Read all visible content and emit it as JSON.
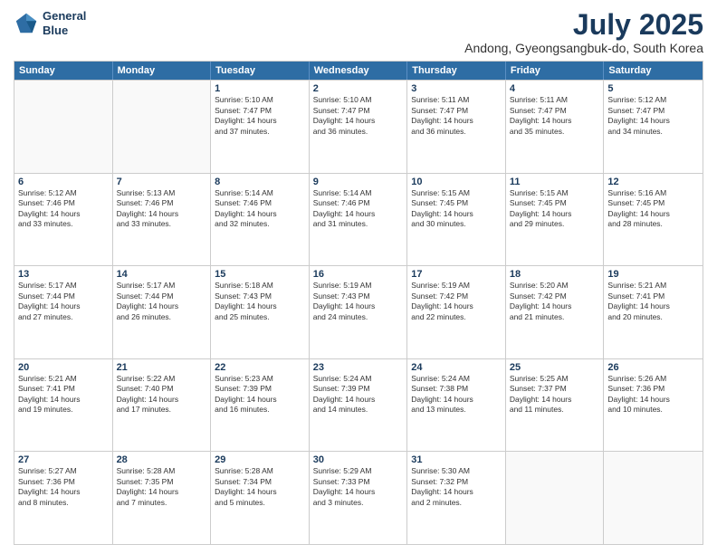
{
  "header": {
    "logo_line1": "General",
    "logo_line2": "Blue",
    "main_title": "July 2025",
    "subtitle": "Andong, Gyeongsangbuk-do, South Korea"
  },
  "days_of_week": [
    "Sunday",
    "Monday",
    "Tuesday",
    "Wednesday",
    "Thursday",
    "Friday",
    "Saturday"
  ],
  "weeks": [
    [
      {
        "day": "",
        "lines": []
      },
      {
        "day": "",
        "lines": []
      },
      {
        "day": "1",
        "lines": [
          "Sunrise: 5:10 AM",
          "Sunset: 7:47 PM",
          "Daylight: 14 hours",
          "and 37 minutes."
        ]
      },
      {
        "day": "2",
        "lines": [
          "Sunrise: 5:10 AM",
          "Sunset: 7:47 PM",
          "Daylight: 14 hours",
          "and 36 minutes."
        ]
      },
      {
        "day": "3",
        "lines": [
          "Sunrise: 5:11 AM",
          "Sunset: 7:47 PM",
          "Daylight: 14 hours",
          "and 36 minutes."
        ]
      },
      {
        "day": "4",
        "lines": [
          "Sunrise: 5:11 AM",
          "Sunset: 7:47 PM",
          "Daylight: 14 hours",
          "and 35 minutes."
        ]
      },
      {
        "day": "5",
        "lines": [
          "Sunrise: 5:12 AM",
          "Sunset: 7:47 PM",
          "Daylight: 14 hours",
          "and 34 minutes."
        ]
      }
    ],
    [
      {
        "day": "6",
        "lines": [
          "Sunrise: 5:12 AM",
          "Sunset: 7:46 PM",
          "Daylight: 14 hours",
          "and 33 minutes."
        ]
      },
      {
        "day": "7",
        "lines": [
          "Sunrise: 5:13 AM",
          "Sunset: 7:46 PM",
          "Daylight: 14 hours",
          "and 33 minutes."
        ]
      },
      {
        "day": "8",
        "lines": [
          "Sunrise: 5:14 AM",
          "Sunset: 7:46 PM",
          "Daylight: 14 hours",
          "and 32 minutes."
        ]
      },
      {
        "day": "9",
        "lines": [
          "Sunrise: 5:14 AM",
          "Sunset: 7:46 PM",
          "Daylight: 14 hours",
          "and 31 minutes."
        ]
      },
      {
        "day": "10",
        "lines": [
          "Sunrise: 5:15 AM",
          "Sunset: 7:45 PM",
          "Daylight: 14 hours",
          "and 30 minutes."
        ]
      },
      {
        "day": "11",
        "lines": [
          "Sunrise: 5:15 AM",
          "Sunset: 7:45 PM",
          "Daylight: 14 hours",
          "and 29 minutes."
        ]
      },
      {
        "day": "12",
        "lines": [
          "Sunrise: 5:16 AM",
          "Sunset: 7:45 PM",
          "Daylight: 14 hours",
          "and 28 minutes."
        ]
      }
    ],
    [
      {
        "day": "13",
        "lines": [
          "Sunrise: 5:17 AM",
          "Sunset: 7:44 PM",
          "Daylight: 14 hours",
          "and 27 minutes."
        ]
      },
      {
        "day": "14",
        "lines": [
          "Sunrise: 5:17 AM",
          "Sunset: 7:44 PM",
          "Daylight: 14 hours",
          "and 26 minutes."
        ]
      },
      {
        "day": "15",
        "lines": [
          "Sunrise: 5:18 AM",
          "Sunset: 7:43 PM",
          "Daylight: 14 hours",
          "and 25 minutes."
        ]
      },
      {
        "day": "16",
        "lines": [
          "Sunrise: 5:19 AM",
          "Sunset: 7:43 PM",
          "Daylight: 14 hours",
          "and 24 minutes."
        ]
      },
      {
        "day": "17",
        "lines": [
          "Sunrise: 5:19 AM",
          "Sunset: 7:42 PM",
          "Daylight: 14 hours",
          "and 22 minutes."
        ]
      },
      {
        "day": "18",
        "lines": [
          "Sunrise: 5:20 AM",
          "Sunset: 7:42 PM",
          "Daylight: 14 hours",
          "and 21 minutes."
        ]
      },
      {
        "day": "19",
        "lines": [
          "Sunrise: 5:21 AM",
          "Sunset: 7:41 PM",
          "Daylight: 14 hours",
          "and 20 minutes."
        ]
      }
    ],
    [
      {
        "day": "20",
        "lines": [
          "Sunrise: 5:21 AM",
          "Sunset: 7:41 PM",
          "Daylight: 14 hours",
          "and 19 minutes."
        ]
      },
      {
        "day": "21",
        "lines": [
          "Sunrise: 5:22 AM",
          "Sunset: 7:40 PM",
          "Daylight: 14 hours",
          "and 17 minutes."
        ]
      },
      {
        "day": "22",
        "lines": [
          "Sunrise: 5:23 AM",
          "Sunset: 7:39 PM",
          "Daylight: 14 hours",
          "and 16 minutes."
        ]
      },
      {
        "day": "23",
        "lines": [
          "Sunrise: 5:24 AM",
          "Sunset: 7:39 PM",
          "Daylight: 14 hours",
          "and 14 minutes."
        ]
      },
      {
        "day": "24",
        "lines": [
          "Sunrise: 5:24 AM",
          "Sunset: 7:38 PM",
          "Daylight: 14 hours",
          "and 13 minutes."
        ]
      },
      {
        "day": "25",
        "lines": [
          "Sunrise: 5:25 AM",
          "Sunset: 7:37 PM",
          "Daylight: 14 hours",
          "and 11 minutes."
        ]
      },
      {
        "day": "26",
        "lines": [
          "Sunrise: 5:26 AM",
          "Sunset: 7:36 PM",
          "Daylight: 14 hours",
          "and 10 minutes."
        ]
      }
    ],
    [
      {
        "day": "27",
        "lines": [
          "Sunrise: 5:27 AM",
          "Sunset: 7:36 PM",
          "Daylight: 14 hours",
          "and 8 minutes."
        ]
      },
      {
        "day": "28",
        "lines": [
          "Sunrise: 5:28 AM",
          "Sunset: 7:35 PM",
          "Daylight: 14 hours",
          "and 7 minutes."
        ]
      },
      {
        "day": "29",
        "lines": [
          "Sunrise: 5:28 AM",
          "Sunset: 7:34 PM",
          "Daylight: 14 hours",
          "and 5 minutes."
        ]
      },
      {
        "day": "30",
        "lines": [
          "Sunrise: 5:29 AM",
          "Sunset: 7:33 PM",
          "Daylight: 14 hours",
          "and 3 minutes."
        ]
      },
      {
        "day": "31",
        "lines": [
          "Sunrise: 5:30 AM",
          "Sunset: 7:32 PM",
          "Daylight: 14 hours",
          "and 2 minutes."
        ]
      },
      {
        "day": "",
        "lines": []
      },
      {
        "day": "",
        "lines": []
      }
    ]
  ]
}
